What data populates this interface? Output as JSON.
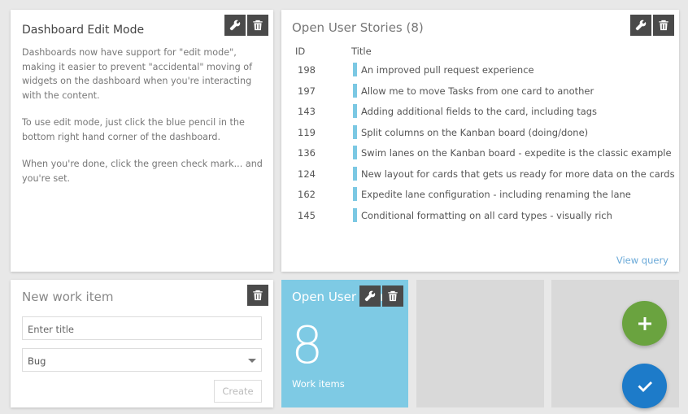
{
  "edit_widget": {
    "title": "Dashboard Edit Mode",
    "paragraphs": [
      "Dashboards now have support for \"edit mode\", making it easier to prevent \"accidental\" moving of widgets on the dashboard when you're interacting with the content.",
      "To use edit mode, just click the blue pencil in the bottom right hand corner of the dashboard.",
      "When you're done, click the green check mark... and you're set."
    ]
  },
  "stories_widget": {
    "title": "Open User Stories (8)",
    "col_id": "ID",
    "col_title": "Title",
    "rows": [
      {
        "id": "198",
        "title": "An improved pull request experience"
      },
      {
        "id": "197",
        "title": "Allow me to move Tasks from one card to another"
      },
      {
        "id": "143",
        "title": "Adding additional fields to the card, including tags"
      },
      {
        "id": "119",
        "title": "Split columns on the Kanban board (doing/done)"
      },
      {
        "id": "136",
        "title": "Swim lanes on the Kanban board - expedite is the classic example"
      },
      {
        "id": "124",
        "title": "New layout for cards that gets us ready for more data on the cards"
      },
      {
        "id": "162",
        "title": "Expedite lane configuration - including renaming the lane"
      },
      {
        "id": "145",
        "title": "Conditional formatting on all card types - visually rich"
      }
    ],
    "view_query": "View query"
  },
  "new_item_widget": {
    "title": "New work item",
    "placeholder": "Enter title",
    "type_value": "Bug",
    "create_label": "Create"
  },
  "count_widget": {
    "title": "Open User Stories",
    "count": "8",
    "label": "Work items"
  },
  "fabs": {
    "add_color": "#6aa33f",
    "done_color": "#1d7bc9"
  },
  "colors": {
    "accent_bar": "#7bc8e3",
    "tile": "#7ecae4",
    "link": "#6aa9d8"
  }
}
